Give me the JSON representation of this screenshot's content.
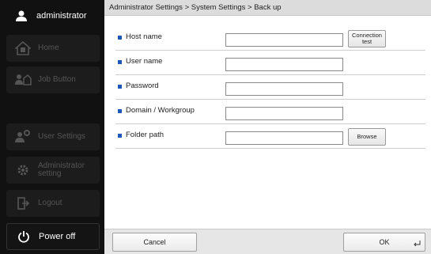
{
  "sidebar": {
    "user": {
      "name": "administrator",
      "icon": "user-icon"
    },
    "items": [
      {
        "label": "Home",
        "icon": "home-icon"
      },
      {
        "label": "Job Button",
        "icon": "job-button-icon"
      },
      {
        "label": "User Settings",
        "icon": "user-settings-icon"
      },
      {
        "label": "Administrator\nsetting",
        "icon": "gear-icon"
      },
      {
        "label": "Logout",
        "icon": "logout-icon"
      }
    ],
    "power": {
      "label": "Power off",
      "icon": "power-icon"
    }
  },
  "breadcrumb": "Administrator Settings > System Settings > Back up",
  "form": {
    "fields": [
      {
        "label": "Host name",
        "value": "",
        "button": "Connection\ntest"
      },
      {
        "label": "User name",
        "value": ""
      },
      {
        "label": "Password",
        "value": ""
      },
      {
        "label": "Domain / Workgroup",
        "value": ""
      },
      {
        "label": "Folder path",
        "value": "",
        "button": "Browse"
      }
    ]
  },
  "footer": {
    "cancel_label": "Cancel",
    "ok_label": "OK"
  },
  "colors": {
    "sidebar_bg": "#111111",
    "bullet": "#1f57b8",
    "breadcrumb_bg": "#dcdcdc"
  }
}
